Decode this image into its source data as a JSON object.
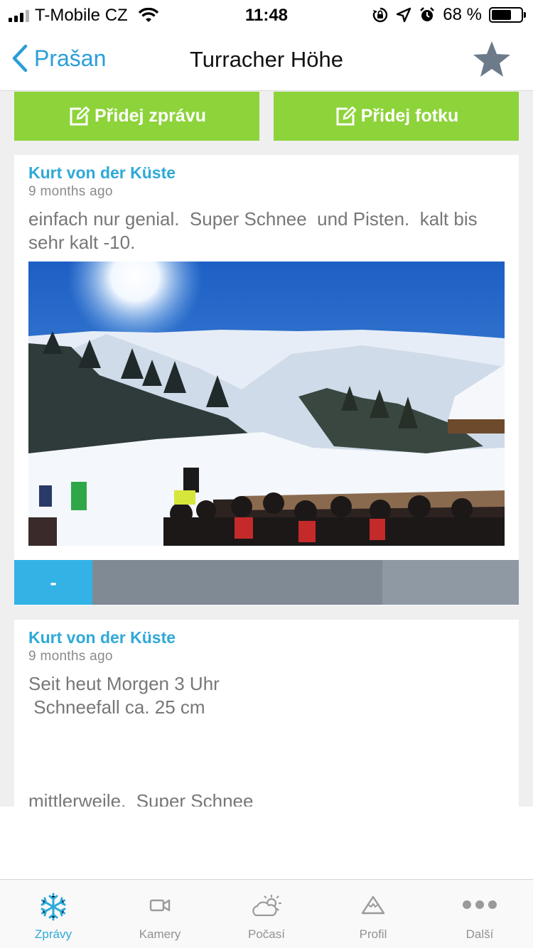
{
  "status": {
    "carrier": "T-Mobile CZ",
    "time": "11:48",
    "battery_text": "68 %",
    "battery_level": 0.68,
    "icons": [
      "signal-icon",
      "wifi-icon",
      "rotation-lock-icon",
      "location-icon",
      "alarm-icon",
      "battery-icon"
    ]
  },
  "nav": {
    "back_label": "Prašan",
    "title": "Turracher Höhe",
    "favorite_icon": "star-icon"
  },
  "actions": {
    "add_message": "Přidej zprávu",
    "add_photo": "Přidej fotku",
    "icon": "edit-icon",
    "color": "#8dd33a"
  },
  "posts": [
    {
      "author": "Kurt von der Küste",
      "time_ago": "9 months ago",
      "text": "einfach nur genial.  Super Schnee  und Pisten.  kalt bis sehr kalt -10.",
      "has_photo": true,
      "rating_label": "-"
    },
    {
      "author": "Kurt von der Küste",
      "time_ago": "9 months ago",
      "text": "Seit heut Morgen 3 Uhr\n Schneefall ca. 25 cm\n\n\n\nmittlerweile.  Super Schnee"
    }
  ],
  "tabs": [
    {
      "label": "Zprávy",
      "icon": "snowflake-icon",
      "active": true
    },
    {
      "label": "Kamery",
      "icon": "video-camera-icon",
      "active": false
    },
    {
      "label": "Počasí",
      "icon": "weather-icon",
      "active": false
    },
    {
      "label": "Profil",
      "icon": "mountain-icon",
      "active": false
    },
    {
      "label": "Další",
      "icon": "more-icon",
      "active": false
    }
  ],
  "colors": {
    "accent": "#2ea9d8",
    "green": "#8dd33a",
    "bar_gray": "#808a94",
    "rating_blue": "#33b2e6"
  }
}
